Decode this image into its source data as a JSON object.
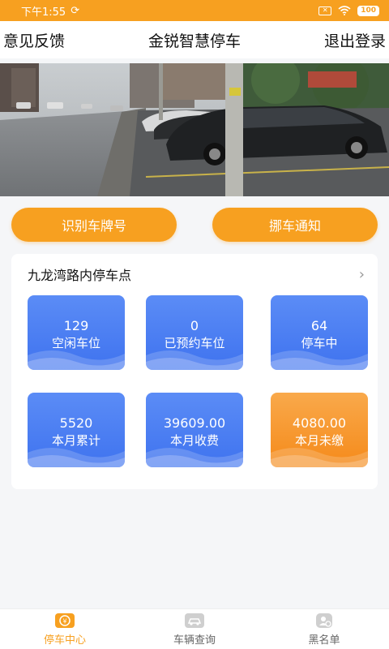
{
  "status_bar": {
    "time": "下午1:55",
    "battery": "100"
  },
  "header": {
    "left_label": "意见反馈",
    "title": "金锐智慧停车",
    "right_label": "退出登录"
  },
  "actions": {
    "identify_plate": "识别车牌号",
    "move_car_notice": "挪车通知"
  },
  "lot": {
    "name": "九龙湾路内停车点",
    "stats": [
      {
        "value": "129",
        "label": "空闲车位",
        "color": "#4a7ff3"
      },
      {
        "value": "0",
        "label": "已预约车位",
        "color": "#4a7ff3"
      },
      {
        "value": "64",
        "label": "停车中",
        "color": "#4a7ff3"
      },
      {
        "value": "5520",
        "label": "本月累计",
        "color": "#4a7ff3"
      },
      {
        "value": "39609.00",
        "label": "本月收费",
        "color": "#4a7ff3"
      },
      {
        "value": "4080.00",
        "label": "本月未缴",
        "color": "#f7931e"
      }
    ]
  },
  "tabs": [
    {
      "label": "停车中心",
      "icon": "parking-center-icon",
      "active": true
    },
    {
      "label": "车辆查询",
      "icon": "car-search-icon",
      "active": false
    },
    {
      "label": "黑名单",
      "icon": "blacklist-icon",
      "active": false
    }
  ],
  "colors": {
    "accent": "#f7a020",
    "tile_blue": "#4a7ff3",
    "tile_orange": "#f7931e"
  }
}
